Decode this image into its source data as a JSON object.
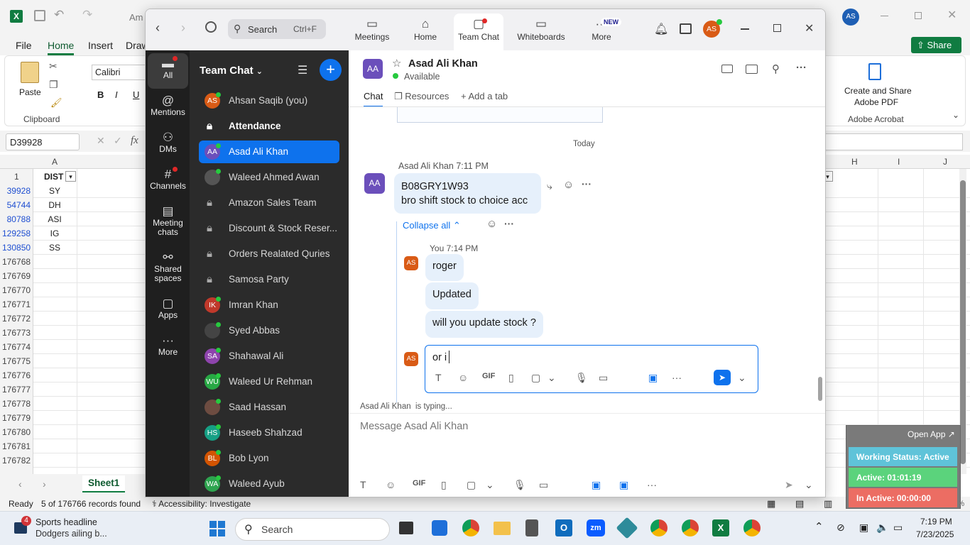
{
  "excel": {
    "title_partial": "Am",
    "tabs": [
      "File",
      "Home",
      "Insert",
      "Draw"
    ],
    "clipboard": {
      "paste": "Paste",
      "group": "Clipboard"
    },
    "font_name": "Calibri",
    "font_buttons": [
      "B",
      "I",
      "U"
    ],
    "acrobat": {
      "create": "Create and Share",
      "adobe_pdf": "Adobe PDF",
      "group": "Adobe Acrobat"
    },
    "share": "Share",
    "name_box": "D39928",
    "fx": "fx",
    "col_headers": {
      "a": "A",
      "h": "H",
      "i": "I",
      "j": "J"
    },
    "header_row": {
      "num": "1",
      "dist": "DIST"
    },
    "rows": [
      {
        "num": "39928",
        "val": "SY"
      },
      {
        "num": "54744",
        "val": "DH"
      },
      {
        "num": "80788",
        "val": "ASI"
      },
      {
        "num": "129258",
        "val": "IG"
      },
      {
        "num": "130850",
        "val": "SS"
      },
      {
        "num": "176768",
        "val": ""
      },
      {
        "num": "176769",
        "val": ""
      },
      {
        "num": "176770",
        "val": ""
      },
      {
        "num": "176771",
        "val": ""
      },
      {
        "num": "176772",
        "val": ""
      },
      {
        "num": "176773",
        "val": ""
      },
      {
        "num": "176774",
        "val": ""
      },
      {
        "num": "176775",
        "val": ""
      },
      {
        "num": "176776",
        "val": ""
      },
      {
        "num": "176777",
        "val": ""
      },
      {
        "num": "176778",
        "val": ""
      },
      {
        "num": "176779",
        "val": ""
      },
      {
        "num": "176780",
        "val": ""
      },
      {
        "num": "176781",
        "val": ""
      },
      {
        "num": "176782",
        "val": ""
      }
    ],
    "sheet_tab": "Sheet1",
    "status": {
      "ready": "Ready",
      "records": "5 of 176766 records found",
      "accessibility": "Accessibility: Investigate",
      "zoom": "100%"
    }
  },
  "zoom": {
    "search": {
      "placeholder": "Search",
      "shortcut": "Ctrl+F"
    },
    "nav": [
      {
        "label": "Meetings",
        "icon": "video-icon"
      },
      {
        "label": "Home",
        "icon": "home-icon"
      },
      {
        "label": "Team Chat",
        "icon": "chat-icon"
      },
      {
        "label": "Whiteboards",
        "icon": "whiteboard-icon"
      },
      {
        "label": "More",
        "icon": "more-icon",
        "badge": "NEW"
      }
    ],
    "user_initials": "AS",
    "rail": [
      {
        "label": "All"
      },
      {
        "label": "Mentions"
      },
      {
        "label": "DMs"
      },
      {
        "label": "Channels"
      },
      {
        "label": "Meeting chats"
      },
      {
        "label": "Shared spaces"
      },
      {
        "label": "Apps"
      },
      {
        "label": "More"
      }
    ],
    "list_header": "Team Chat",
    "contacts": [
      {
        "name": "Ahsan Saqib (you)",
        "initials": "AS",
        "color": "#d95b16",
        "type": "user"
      },
      {
        "name": "Attendance",
        "type": "channel",
        "bold": true
      },
      {
        "name": "Asad Ali Khan",
        "initials": "AA",
        "color": "#6b4fbb",
        "type": "user",
        "selected": true
      },
      {
        "name": "Waleed Ahmed Awan",
        "initials": "",
        "color": "#555",
        "type": "photo"
      },
      {
        "name": "Amazon Sales Team",
        "type": "channel"
      },
      {
        "name": "Discount & Stock Reser...",
        "type": "channel"
      },
      {
        "name": "Orders Realated Quries",
        "type": "channel"
      },
      {
        "name": "Samosa Party",
        "type": "channel"
      },
      {
        "name": "Imran Khan",
        "initials": "IK",
        "color": "#c0392b",
        "type": "user"
      },
      {
        "name": "Syed Abbas",
        "initials": "",
        "color": "#444",
        "type": "photo"
      },
      {
        "name": "Shahawal Ali",
        "initials": "SA",
        "color": "#8e44ad",
        "type": "user"
      },
      {
        "name": "Waleed Ur Rehman",
        "initials": "WU",
        "color": "#27a844",
        "type": "user"
      },
      {
        "name": "Saad Hassan",
        "initials": "",
        "color": "#6d4c41",
        "type": "photo"
      },
      {
        "name": "Haseeb Shahzad",
        "initials": "HS",
        "color": "#16a085",
        "type": "user"
      },
      {
        "name": "Bob Lyon",
        "initials": "BL",
        "color": "#d35400",
        "type": "user"
      },
      {
        "name": "Waleed Ayub",
        "initials": "WA",
        "color": "#2ea44f",
        "type": "user"
      }
    ],
    "chat": {
      "contact": "Asad Ali Khan",
      "initials": "AA",
      "status": "Available",
      "tabs": [
        "Chat",
        "Resources",
        "Add a tab"
      ],
      "day_divider": "Today",
      "msg1": {
        "sender": "Asad Ali Khan",
        "time": "7:11 PM",
        "line1": "B08GRY1W93",
        "line2": "bro shift stock to choice acc"
      },
      "collapse": "Collapse all",
      "reply_header": "You 7:14 PM",
      "replies": [
        "roger",
        "Updated",
        "will you update stock ?"
      ],
      "draft": "or i",
      "typing": "Asad Ali Khan  is typing...",
      "placeholder": "Message Asad Ali Khan"
    }
  },
  "widget": {
    "open_app": "Open App",
    "working": "Working Status: Active",
    "active": "Active: 01:01:19",
    "inactive": "In Active: 00:00:00"
  },
  "taskbar": {
    "news_title": "Sports headline",
    "news_sub": "Dodgers ailing b...",
    "news_badge": "4",
    "search": "Search",
    "time": "7:19 PM",
    "date": "7/23/2025"
  }
}
